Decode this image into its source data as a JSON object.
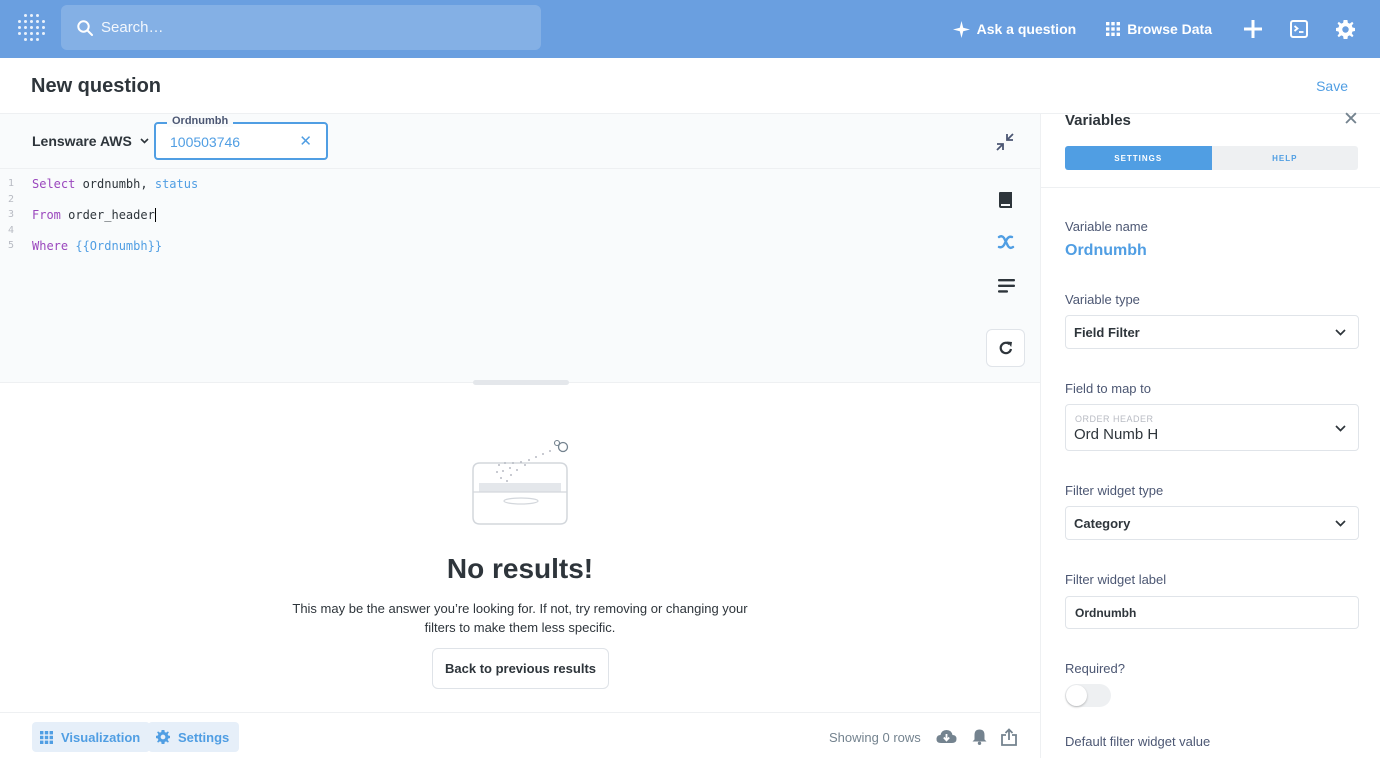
{
  "nav": {
    "search_placeholder": "Search…",
    "ask_question": "Ask a question",
    "browse_data": "Browse Data",
    "icons": [
      "metabase-logo-icon",
      "search-icon",
      "sparkle-icon",
      "grid-icon",
      "plus-icon",
      "sql-editor-icon",
      "gear-icon"
    ]
  },
  "header": {
    "title": "New question",
    "save": "Save"
  },
  "editor": {
    "database": "Lensware AWS",
    "variable_widget": {
      "label": "Ordnumbh",
      "value": "100503746"
    },
    "lines": [
      {
        "num": "1",
        "keyword": "Select",
        "rest": " ordnumbh, ",
        "extra": "status"
      },
      {
        "num": "2"
      },
      {
        "num": "3",
        "keyword": "From",
        "rest": " order_header"
      },
      {
        "num": "4"
      },
      {
        "num": "5",
        "keyword": "Where",
        "tag": "{{Ordnumbh}}"
      }
    ]
  },
  "results": {
    "heading": "No results!",
    "description": "This may be the answer you’re looking for. If not, try removing or changing your filters to make them less specific.",
    "back_button": "Back to previous results"
  },
  "footer": {
    "visualization": "Visualization",
    "settings": "Settings",
    "rows": "Showing 0 rows"
  },
  "panel": {
    "title": "Variables",
    "tabs": [
      "SETTINGS",
      "HELP"
    ],
    "variable_name_label": "Variable name",
    "variable_name": "Ordnumbh",
    "variable_type_label": "Variable type",
    "variable_type": "Field Filter",
    "field_map_label": "Field to map to",
    "field_map_table": "ORDER HEADER",
    "field_map_field": "Ord Numb H",
    "widget_type_label": "Filter widget type",
    "widget_type": "Category",
    "widget_label_label": "Filter widget label",
    "widget_label_value": "Ordnumbh",
    "required_label": "Required?",
    "default_label": "Default filter widget value"
  },
  "colors": {
    "brand": "#509ee3",
    "nav": "#6a9fe0",
    "keyword": "#9a47bd"
  }
}
